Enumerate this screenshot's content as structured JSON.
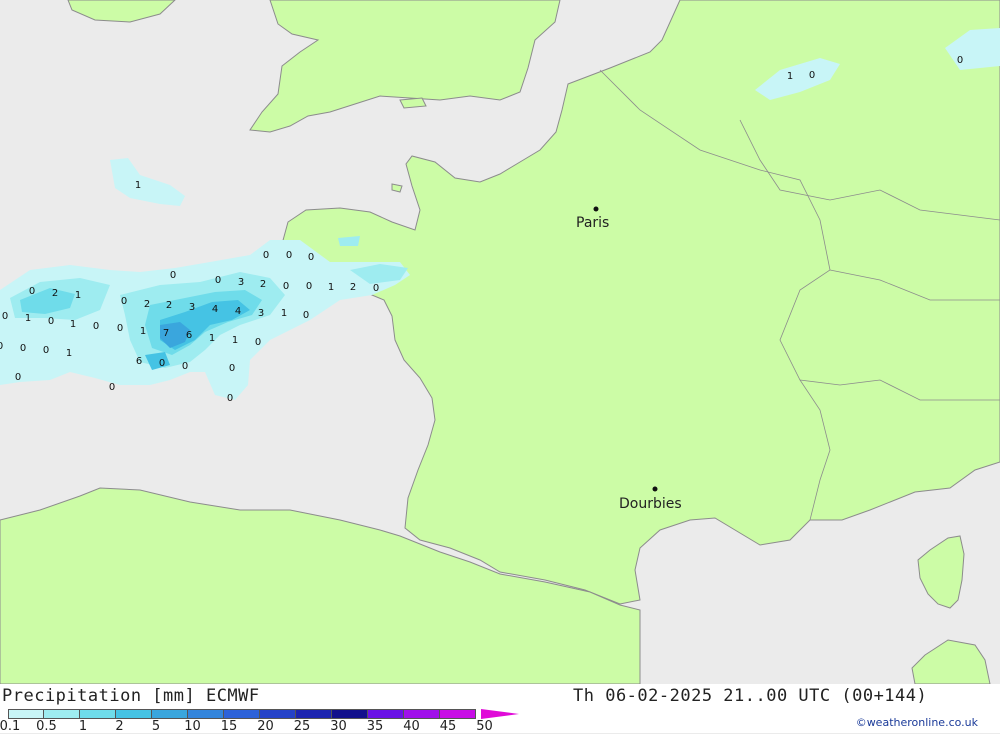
{
  "map": {
    "cities": [
      {
        "name": "Paris"
      },
      {
        "name": "Dourbies"
      }
    ],
    "values": [
      "1",
      "0",
      "0",
      "0",
      "0",
      "0",
      "3",
      "2",
      "0",
      "0",
      "1",
      "2",
      "0",
      "0",
      "2",
      "1",
      "0",
      "2",
      "2",
      "3",
      "4",
      "4",
      "3",
      "1",
      "0",
      "0",
      "1",
      "0",
      "1",
      "0",
      "0",
      "1",
      "7",
      "6",
      "1",
      "1",
      "0",
      "0",
      "0",
      "0",
      "1",
      "6",
      "0",
      "0",
      "0",
      "0",
      "0",
      "0",
      "1",
      "0",
      "0"
    ]
  },
  "footer": {
    "title": "Precipitation [mm] ECMWF",
    "datetime": "Th 06-02-2025 21..00 UTC (00+144)",
    "credit": "©weatheronline.co.uk"
  },
  "legend": {
    "colors": [
      "#c8f5f7",
      "#9eecf0",
      "#6fdcea",
      "#45c3e4",
      "#3aa6dd",
      "#3385dc",
      "#2d62d9",
      "#2542c8",
      "#1c24b0",
      "#12108c",
      "#6a12e6",
      "#a010ea",
      "#c80ee6",
      "#e00ad8",
      "#c407a8"
    ],
    "labels": [
      "0.1",
      "0.5",
      "1",
      "2",
      "5",
      "10",
      "15",
      "20",
      "25",
      "30",
      "35",
      "40",
      "45",
      "50"
    ]
  }
}
